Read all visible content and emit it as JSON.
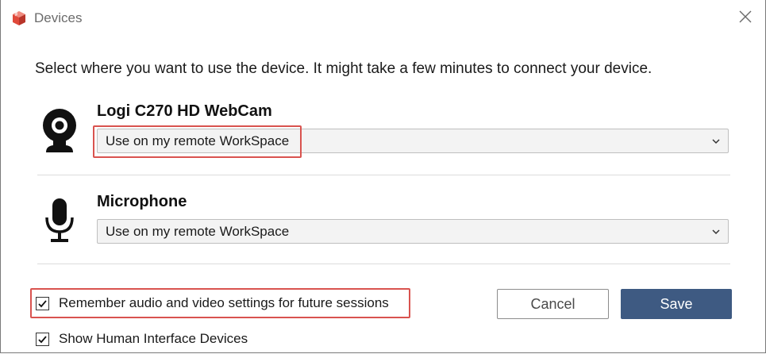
{
  "window": {
    "title": "Devices",
    "close_icon": "close-icon",
    "app_icon": "workspaces-cube-icon"
  },
  "instructions": "Select where you want to use the device. It might take a few minutes to connect your device.",
  "devices": [
    {
      "name": "Logi C270 HD WebCam",
      "icon": "webcam-icon",
      "selected": "Use on my remote WorkSpace",
      "highlighted": true
    },
    {
      "name": "Microphone",
      "icon": "microphone-icon",
      "selected": "Use on my remote WorkSpace",
      "highlighted": false
    }
  ],
  "options": {
    "remember": {
      "label": "Remember audio and video settings for future sessions",
      "checked": true,
      "highlighted": true
    },
    "show_hid": {
      "label": "Show Human Interface Devices",
      "checked": true
    }
  },
  "buttons": {
    "cancel": "Cancel",
    "save": "Save"
  },
  "colors": {
    "accent": "#3e5a82",
    "highlight": "#d9534f",
    "app_icon": "#e0493a"
  }
}
